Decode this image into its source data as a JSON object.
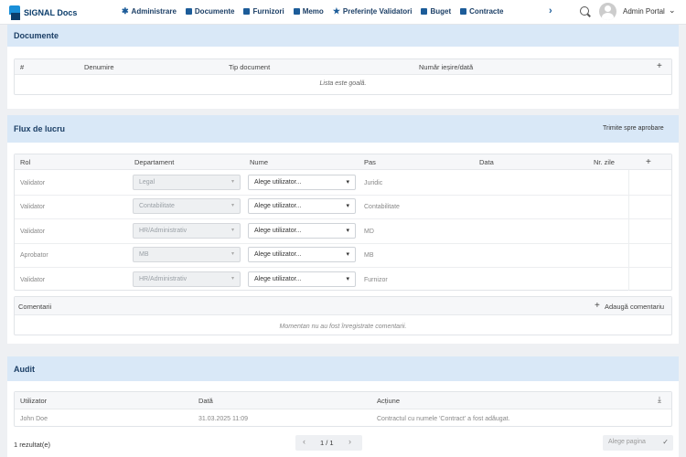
{
  "brand": {
    "name": "SIGNAL Docs"
  },
  "nav": [
    {
      "label": "Administrare",
      "icon": "admin-icon"
    },
    {
      "label": "Documente",
      "icon": "documents-icon"
    },
    {
      "label": "Furnizori",
      "icon": "suppliers-icon"
    },
    {
      "label": "Memo",
      "icon": "memo-icon"
    },
    {
      "label": "Preferințe Validatori",
      "icon": "star-icon"
    },
    {
      "label": "Buget",
      "icon": "budget-icon"
    },
    {
      "label": "Contracte",
      "icon": "contracts-icon"
    }
  ],
  "user": {
    "name": "Admin Portal"
  },
  "documents": {
    "title": "Documente",
    "columns": [
      "#",
      "Denumire",
      "Tip document",
      "Număr ieșire/dată"
    ],
    "add_label": "+",
    "empty_text": "Lista este goală."
  },
  "workflow": {
    "title": "Flux de lucru",
    "send_label": "Trimite spre aprobare",
    "columns": [
      "Rol",
      "Departament",
      "Nume",
      "Pas",
      "Data",
      "Nr. zile"
    ],
    "add_label": "+",
    "rows": [
      {
        "role": "Validator",
        "department": "Legal",
        "name": "Alege utilizator...",
        "step": "Juridic"
      },
      {
        "role": "Validator",
        "department": "Contabilitate",
        "name": "Alege utilizator...",
        "step": "Contabilitate"
      },
      {
        "role": "Validator",
        "department": "HR/Administrativ",
        "name": "Alege utilizator...",
        "step": "MD"
      },
      {
        "role": "Aprobator",
        "department": "MB",
        "name": "Alege utilizator...",
        "step": "MB"
      },
      {
        "role": "Validator",
        "department": "HR/Administrativ",
        "name": "Alege utilizator...",
        "step": "Furnizor"
      }
    ],
    "comments": {
      "title": "Comentarii",
      "add_label": "Adaugă comentariu",
      "empty_text": "Momentan nu au fost înregistrate comentarii."
    }
  },
  "audit": {
    "title": "Audit",
    "columns": [
      "Utilizator",
      "Dată",
      "Acțiune"
    ],
    "rows": [
      {
        "user": "John Doe",
        "date": "31.03.2025 11:09",
        "action": "Contractul cu numele 'Contract' a fost adăugat."
      }
    ],
    "result_count": "1 rezultat(e)",
    "page_indicator": "1 / 1",
    "page_select_placeholder": "Alege pagina"
  }
}
